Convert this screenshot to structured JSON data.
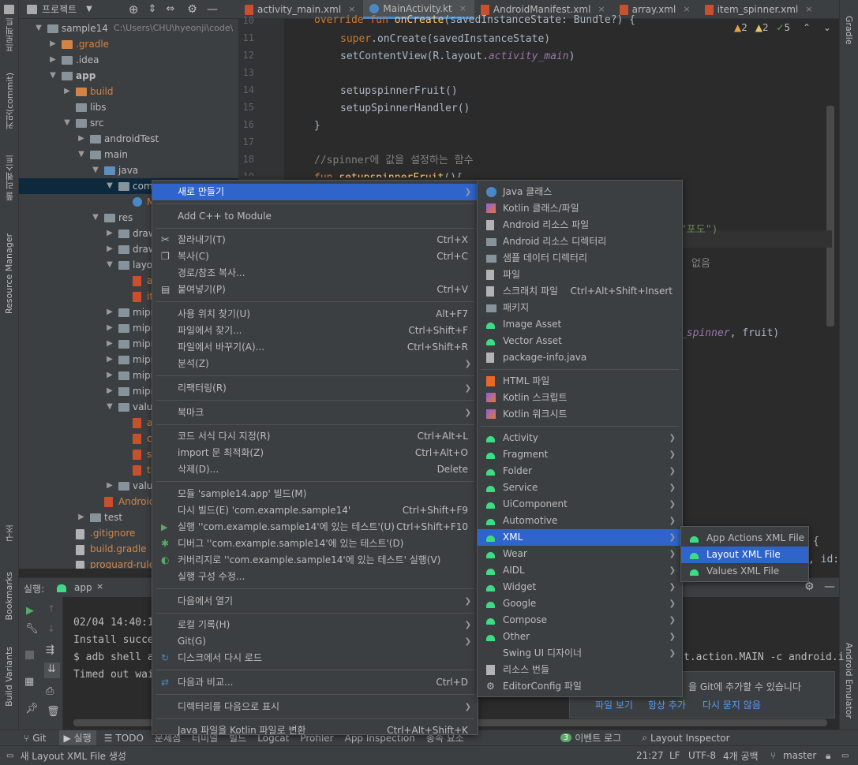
{
  "left_strip": [
    "프로젝트",
    "커밋(commit)",
    "풀 리퀘스트",
    "Resource Manager",
    "구조",
    "Bookmarks",
    "Build Variants"
  ],
  "right_strip": [
    "Gradle",
    "Android Emulator"
  ],
  "project_header": {
    "title": "프로젝트"
  },
  "tree": [
    {
      "label": "sample14",
      "extra": "C:\\Users\\CHU\\hyeonji\\code\\",
      "indent": 0,
      "arrow": "▼",
      "icon": "fold"
    },
    {
      "label": ".gradle",
      "indent": 1,
      "arrow": "▶",
      "icon": "fold-o",
      "color": "#d28445"
    },
    {
      "label": ".idea",
      "indent": 1,
      "arrow": "▶",
      "icon": "fold"
    },
    {
      "label": "app",
      "indent": 1,
      "arrow": "▼",
      "icon": "fold",
      "bold": true
    },
    {
      "label": "build",
      "indent": 2,
      "arrow": "▶",
      "icon": "fold-o",
      "color": "#d28445"
    },
    {
      "label": "libs",
      "indent": 2,
      "arrow": "",
      "icon": "fold"
    },
    {
      "label": "src",
      "indent": 2,
      "arrow": "▼",
      "icon": "fold"
    },
    {
      "label": "androidTest",
      "indent": 3,
      "arrow": "▶",
      "icon": "fold"
    },
    {
      "label": "main",
      "indent": 3,
      "arrow": "▼",
      "icon": "fold"
    },
    {
      "label": "java",
      "indent": 4,
      "arrow": "▼",
      "icon": "fold-b"
    },
    {
      "label": "com.ex",
      "indent": 5,
      "arrow": "▼",
      "icon": "fold",
      "selected": true
    },
    {
      "label": "Ma",
      "indent": 6,
      "arrow": "",
      "icon": "kt",
      "color": "#d28445"
    },
    {
      "label": "res",
      "indent": 4,
      "arrow": "▼",
      "icon": "fold"
    },
    {
      "label": "drawab",
      "indent": 5,
      "arrow": "▶",
      "icon": "fold"
    },
    {
      "label": "drawab",
      "indent": 5,
      "arrow": "▶",
      "icon": "fold"
    },
    {
      "label": "layout",
      "indent": 5,
      "arrow": "▼",
      "icon": "fold"
    },
    {
      "label": "acti",
      "indent": 6,
      "arrow": "",
      "icon": "filex",
      "color": "#d28445"
    },
    {
      "label": "iter",
      "indent": 6,
      "arrow": "",
      "icon": "filex",
      "color": "#d28445"
    },
    {
      "label": "mipma",
      "indent": 5,
      "arrow": "▶",
      "icon": "fold"
    },
    {
      "label": "mipma",
      "indent": 5,
      "arrow": "▶",
      "icon": "fold"
    },
    {
      "label": "mipma",
      "indent": 5,
      "arrow": "▶",
      "icon": "fold"
    },
    {
      "label": "mipma",
      "indent": 5,
      "arrow": "▶",
      "icon": "fold"
    },
    {
      "label": "mipma",
      "indent": 5,
      "arrow": "▶",
      "icon": "fold"
    },
    {
      "label": "mipma",
      "indent": 5,
      "arrow": "▶",
      "icon": "fold"
    },
    {
      "label": "values",
      "indent": 5,
      "arrow": "▼",
      "icon": "fold"
    },
    {
      "label": "arra",
      "indent": 6,
      "arrow": "",
      "icon": "filex",
      "color": "#d28445"
    },
    {
      "label": "colo",
      "indent": 6,
      "arrow": "",
      "icon": "filex",
      "color": "#d28445"
    },
    {
      "label": "strir",
      "indent": 6,
      "arrow": "",
      "icon": "filex",
      "color": "#d28445"
    },
    {
      "label": "the",
      "indent": 6,
      "arrow": "",
      "icon": "filex",
      "color": "#d28445"
    },
    {
      "label": "values-",
      "indent": 5,
      "arrow": "▶",
      "icon": "fold"
    },
    {
      "label": "AndroidM",
      "indent": 4,
      "arrow": "",
      "icon": "filex",
      "color": "#d28445"
    },
    {
      "label": "test",
      "indent": 3,
      "arrow": "▶",
      "icon": "fold"
    },
    {
      "label": ".gitignore",
      "indent": 2,
      "arrow": "",
      "icon": "fileic",
      "color": "#d28445"
    },
    {
      "label": "build.gradle",
      "indent": 2,
      "arrow": "",
      "icon": "fileic",
      "color": "#d28445"
    },
    {
      "label": "proguard-rules.p",
      "indent": 2,
      "arrow": "",
      "icon": "fileic",
      "color": "#d28445"
    }
  ],
  "tabs": [
    {
      "label": "activity_main.xml",
      "active": false
    },
    {
      "label": "MainActivity.kt",
      "active": true
    },
    {
      "label": "AndroidManifest.xml",
      "active": false
    },
    {
      "label": "array.xml",
      "active": false
    },
    {
      "label": "item_spinner.xml",
      "active": false
    }
  ],
  "inspections": {
    "warn1": "2",
    "warn2": "2",
    "ok": "5"
  },
  "line_numbers": [
    "10",
    "11",
    "12",
    "13",
    "14",
    "15",
    "16",
    "17",
    "18",
    "19"
  ],
  "code_visible": {
    "l10a": "override fun ",
    "l10b": "onCreate",
    "l10c": "(savedInstanceState: Bundle?) {",
    "l11a": "super",
    "l11b": ".onCreate(savedInstanceState)",
    "l12a": "setContentView(R.layout.",
    "l12b": "activity_main",
    "l12c": ")",
    "l14": "setupspinnerFruit()",
    "l15": "setupSpinnerHandler()",
    "l16": "}",
    "l18": "//spinner에 값을 설정하는 함수",
    "l19a": "fun ",
    "l19b": "setupspinnerFruit",
    "l19c": "(){",
    "frag1": "\"포도\")",
    "frag2": "없음",
    "frag3a": "_spinner",
    ", ": "",
    "frag3b": ", fruit)",
    "frag4": "{",
    "frag5": ", id:",
    "frag6": "t.action.MAIN -c android.i"
  },
  "run_panel": {
    "title": "실행:",
    "tab": "app"
  },
  "console": [
    "02/04 14:40:1",
    "Install succe",
    "$ adb shell a",
    "Timed out wai"
  ],
  "notification": {
    "text": "을 Git에 추가할 수 있습니다",
    "actions": [
      "파일 보기",
      "항상 추가",
      "다시 묻지 않음"
    ]
  },
  "bottom_tools": [
    "Git",
    "실행",
    "TODO",
    "문제점",
    "터미널",
    "빌드",
    "Logcat",
    "Profiler",
    "App Inspection",
    "종속 요소",
    "이벤트 로그",
    "Layout Inspector"
  ],
  "bottom_badge": "3",
  "status": {
    "message": "새 Layout XML File 생성",
    "pos": "21:27",
    "eol": "LF",
    "enc": "UTF-8",
    "indent": "4개 공백",
    "branch": "master"
  },
  "menu1": [
    {
      "label": "새로 만들기",
      "sub": true,
      "sel": true
    },
    {
      "sep": true
    },
    {
      "label": "Add C++ to Module"
    },
    {
      "sep": true
    },
    {
      "label": "잘라내기(T)",
      "short": "Ctrl+X",
      "icon": "scissors-icon"
    },
    {
      "label": "복사(C)",
      "short": "Ctrl+C",
      "icon": "copy-icon"
    },
    {
      "label": "경로/참조 복사..."
    },
    {
      "label": "붙여넣기(P)",
      "short": "Ctrl+V",
      "icon": "paste-icon"
    },
    {
      "sep": true
    },
    {
      "label": "사용 위치 찾기(U)",
      "short": "Alt+F7"
    },
    {
      "label": "파일에서 찾기...",
      "short": "Ctrl+Shift+F"
    },
    {
      "label": "파일에서 바꾸기(A)...",
      "short": "Ctrl+Shift+R"
    },
    {
      "label": "분석(Z)",
      "sub": true
    },
    {
      "sep": true
    },
    {
      "label": "리팩터링(R)",
      "sub": true
    },
    {
      "sep": true
    },
    {
      "label": "북마크",
      "sub": true
    },
    {
      "sep": true
    },
    {
      "label": "코드 서식 다시 지정(R)",
      "short": "Ctrl+Alt+L"
    },
    {
      "label": "import 문 최적화(Z)",
      "short": "Ctrl+Alt+O"
    },
    {
      "label": "삭제(D)...",
      "short": "Delete"
    },
    {
      "sep": true
    },
    {
      "label": "모듈 'sample14.app' 빌드(M)"
    },
    {
      "label": "다시 빌드(E) 'com.example.sample14'",
      "short": "Ctrl+Shift+F9"
    },
    {
      "label": "실행 ''com.example.sample14'에 있는 테스트'(U)",
      "short": "Ctrl+Shift+F10",
      "icon": "run-icon"
    },
    {
      "label": "디버그 ''com.example.sample14'에 있는 테스트'(D)",
      "icon": "debug-icon"
    },
    {
      "label": "커버리지로 ''com.example.sample14'에 있는 테스트' 실행(V)",
      "icon": "coverage-icon"
    },
    {
      "label": "실행 구성 수정..."
    },
    {
      "sep": true
    },
    {
      "label": "다음에서 열기",
      "sub": true
    },
    {
      "sep": true
    },
    {
      "label": "로컬 기록(H)",
      "sub": true
    },
    {
      "label": "Git(G)",
      "sub": true
    },
    {
      "label": "디스크에서 다시 로드",
      "icon": "reload-icon"
    },
    {
      "sep": true
    },
    {
      "label": "다음과 비교...",
      "short": "Ctrl+D",
      "icon": "compare-icon"
    },
    {
      "sep": true
    },
    {
      "label": "디렉터리를 다음으로 표시",
      "sub": true
    },
    {
      "sep": true
    },
    {
      "label": "Java 파일을 Kotlin 파일로 변환",
      "short": "Ctrl+Alt+Shift+K"
    }
  ],
  "menu2": [
    {
      "label": "Java 클래스",
      "icon": "java-class-icon"
    },
    {
      "label": "Kotlin 클래스/파일",
      "icon": "kotlin-icon"
    },
    {
      "label": "Android 리소스 파일",
      "icon": "resource-file-icon"
    },
    {
      "label": "Android 리소스 디렉터리",
      "icon": "folder-icon"
    },
    {
      "label": "샘플 데이터 디렉터리",
      "icon": "folder-icon"
    },
    {
      "label": "파일",
      "icon": "file-icon"
    },
    {
      "label": "스크래치 파일",
      "short": "Ctrl+Alt+Shift+Insert",
      "icon": "scratch-icon"
    },
    {
      "label": "패키지",
      "icon": "package-icon"
    },
    {
      "label": "Image Asset",
      "icon": "android-icon"
    },
    {
      "label": "Vector Asset",
      "icon": "android-icon"
    },
    {
      "label": "package-info.java",
      "icon": "file-icon"
    },
    {
      "sep": true
    },
    {
      "label": "HTML 파일",
      "icon": "html-icon"
    },
    {
      "label": "Kotlin 스크립트",
      "icon": "kotlin-icon"
    },
    {
      "label": "Kotlin 워크시트",
      "icon": "kotlin-icon"
    },
    {
      "sep": true
    },
    {
      "label": "Activity",
      "sub": true,
      "icon": "android-icon"
    },
    {
      "label": "Fragment",
      "sub": true,
      "icon": "android-icon"
    },
    {
      "label": "Folder",
      "sub": true,
      "icon": "android-icon"
    },
    {
      "label": "Service",
      "sub": true,
      "icon": "android-icon"
    },
    {
      "label": "UiComponent",
      "sub": true,
      "icon": "android-icon"
    },
    {
      "label": "Automotive",
      "sub": true,
      "icon": "android-icon"
    },
    {
      "label": "XML",
      "sub": true,
      "icon": "android-icon",
      "sel": true
    },
    {
      "label": "Wear",
      "sub": true,
      "icon": "android-icon"
    },
    {
      "label": "AIDL",
      "sub": true,
      "icon": "android-icon"
    },
    {
      "label": "Widget",
      "sub": true,
      "icon": "android-icon"
    },
    {
      "label": "Google",
      "sub": true,
      "icon": "android-icon"
    },
    {
      "label": "Compose",
      "sub": true,
      "icon": "android-icon"
    },
    {
      "label": "Other",
      "sub": true,
      "icon": "android-icon"
    },
    {
      "label": "Swing UI 디자이너",
      "sub": true
    },
    {
      "label": "리소스 번들",
      "icon": "bundle-icon"
    },
    {
      "label": "EditorConfig 파일",
      "icon": "gear-icon"
    }
  ],
  "menu3": [
    {
      "label": "App Actions XML File",
      "icon": "android-icon"
    },
    {
      "label": "Layout XML File",
      "icon": "android-icon",
      "sel": true
    },
    {
      "label": "Values XML File",
      "icon": "android-icon"
    }
  ]
}
